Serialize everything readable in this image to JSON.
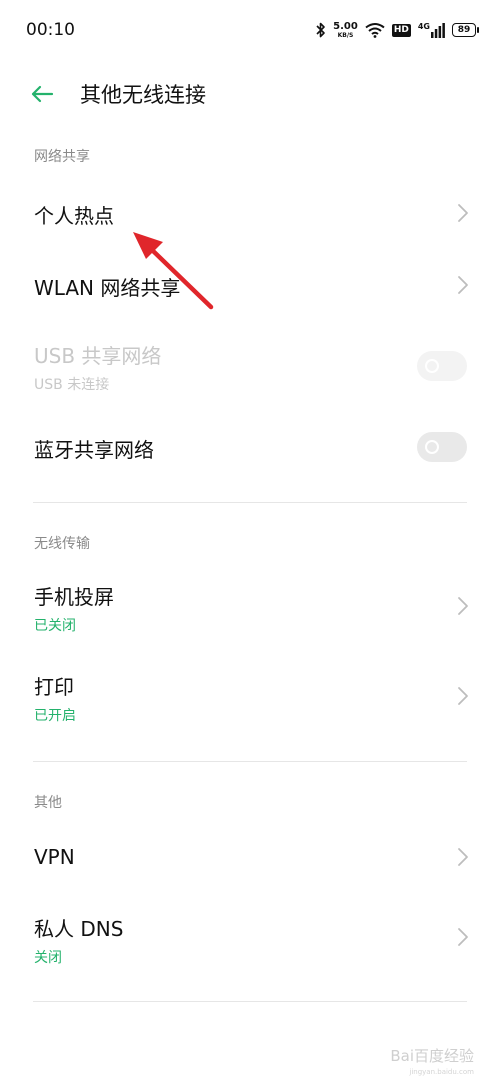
{
  "status_bar": {
    "time": "00:10",
    "net_speed_value": "5.00",
    "net_speed_unit": "KB/S",
    "hd_label": "HD",
    "network_type": "4G",
    "battery_level": "89"
  },
  "header": {
    "title": "其他无线连接"
  },
  "sections": {
    "sharing": {
      "header": "网络共享",
      "hotspot": "个人热点",
      "wlan_sharing": "WLAN 网络共享",
      "usb_sharing": "USB 共享网络",
      "usb_sharing_status": "USB 未连接",
      "bluetooth_sharing": "蓝牙共享网络"
    },
    "wireless_transfer": {
      "header": "无线传输",
      "screen_cast": "手机投屏",
      "screen_cast_status": "已关闭",
      "print": "打印",
      "print_status": "已开启"
    },
    "other": {
      "header": "其他",
      "vpn": "VPN",
      "private_dns": "私人 DNS",
      "private_dns_status": "关闭"
    }
  },
  "toggles": {
    "usb_sharing_on": false,
    "bluetooth_sharing_on": false
  },
  "watermark": {
    "text": "Bai百度经验",
    "url": "jingyan.baidu.com"
  },
  "colors": {
    "accent_green": "#24b26c",
    "annotation_red": "#e0262b"
  }
}
